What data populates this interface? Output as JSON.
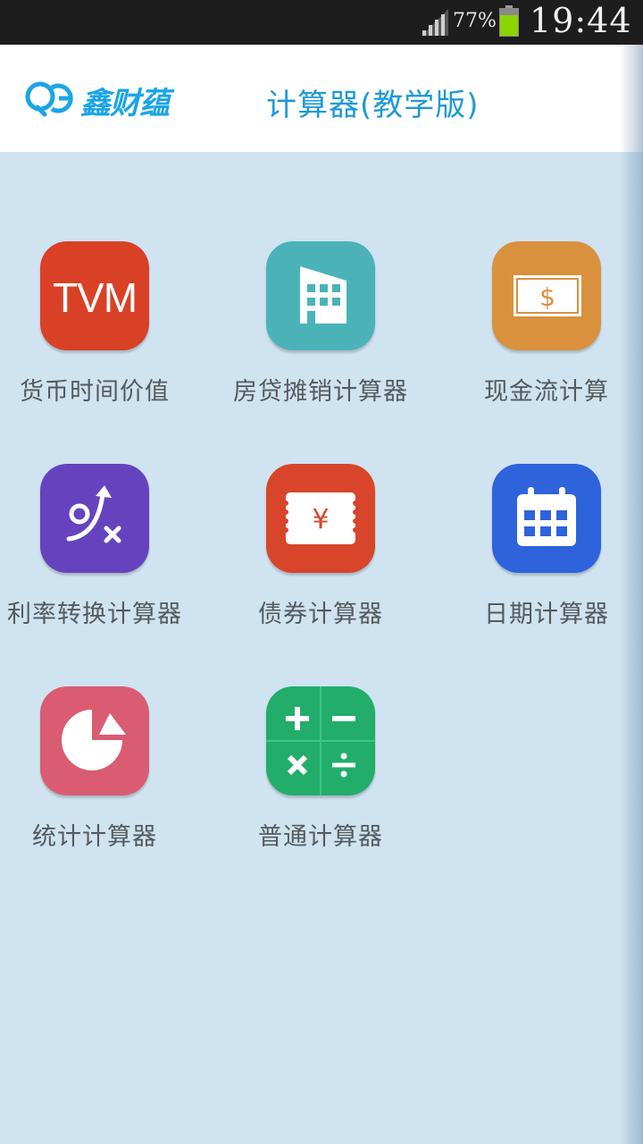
{
  "status_bar": {
    "battery_percent": "77%",
    "time": "19:44",
    "battery_color": "#8cd400"
  },
  "header": {
    "logo_text": "鑫财蕴",
    "title": "计算器(教学版)",
    "title_color": "#1e9ad6"
  },
  "tiles": [
    {
      "label": "货币时间价值",
      "icon": "tvm-icon",
      "icon_text": "TVM",
      "color": "#d94127"
    },
    {
      "label": "房贷摊销计算器",
      "icon": "building-icon",
      "color": "#4bb3b8"
    },
    {
      "label": "现金流计算",
      "icon": "banknote-icon",
      "color": "#d9913e"
    },
    {
      "label": "利率转换计算器",
      "icon": "rate-convert-icon",
      "color": "#6543bf"
    },
    {
      "label": "债券计算器",
      "icon": "bond-ticket-icon",
      "color": "#d8452a"
    },
    {
      "label": "日期计算器",
      "icon": "calendar-icon",
      "color": "#2e63dc"
    },
    {
      "label": "统计计算器",
      "icon": "pie-chart-icon",
      "color": "#d95c73"
    },
    {
      "label": "普通计算器",
      "icon": "calculator-icon",
      "color": "#22ad6b"
    }
  ]
}
